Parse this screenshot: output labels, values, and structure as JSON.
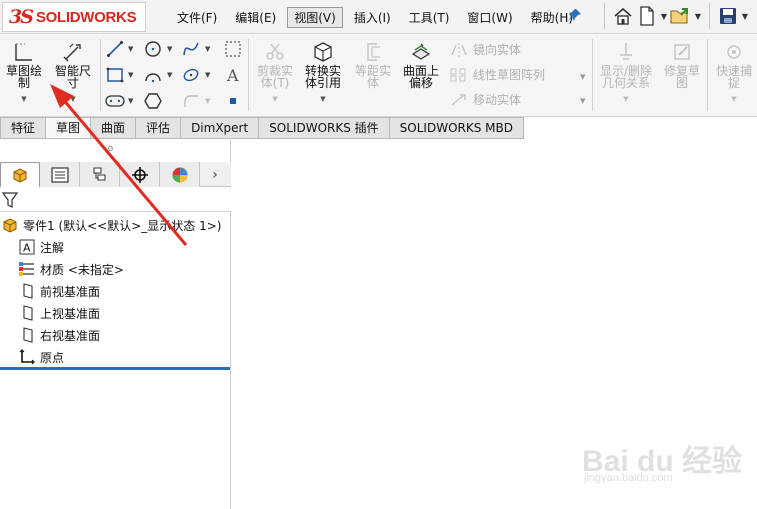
{
  "app": {
    "logo_prefix": "3S",
    "logo_text": "SOLIDWORKS"
  },
  "menu": [
    {
      "label": "文件(F)"
    },
    {
      "label": "编辑(E)"
    },
    {
      "label": "视图(V)"
    },
    {
      "label": "插入(I)"
    },
    {
      "label": "工具(T)"
    },
    {
      "label": "窗口(W)"
    },
    {
      "label": "帮助(H)"
    }
  ],
  "quickbar_icons": [
    "home-icon",
    "new-document-icon",
    "open-folder-icon",
    "save-icon"
  ],
  "ribbon": {
    "sketch": {
      "line1": "草图绘",
      "line2": "制"
    },
    "smart_dimension": {
      "line1": "智能尺",
      "line2": "寸"
    },
    "trim": {
      "line1": "剪裁实",
      "line2": "体(T)"
    },
    "convert": {
      "line1": "转换实",
      "line2": "体引用"
    },
    "offset": {
      "line1": "等距实",
      "line2": "体"
    },
    "surface_offset": {
      "line1": "曲面上",
      "line2": "偏移"
    },
    "mirror": "镜向实体",
    "linear_pattern": "线性草图阵列",
    "move": "移动实体",
    "show_relations": {
      "line1": "显示/删除",
      "line2": "几何关系"
    },
    "repair": {
      "line1": "修复草",
      "line2": "图"
    },
    "quick_snap": {
      "line1": "快速捕",
      "line2": "捉"
    }
  },
  "tabs": [
    {
      "label": "特征",
      "active": false
    },
    {
      "label": "草图",
      "active": true
    },
    {
      "label": "曲面",
      "active": false
    },
    {
      "label": "评估",
      "active": false
    },
    {
      "label": "DimXpert",
      "active": false
    },
    {
      "label": "SOLIDWORKS 插件",
      "active": false
    },
    {
      "label": "SOLIDWORKS MBD",
      "active": false
    }
  ],
  "panel_tabs": [
    "feature-manager-icon",
    "property-manager-icon",
    "configuration-manager-icon",
    "dimxpert-manager-icon",
    "display-manager-icon"
  ],
  "tree": {
    "root": "零件1 (默认<<默认>_显示状态 1>)",
    "items": [
      {
        "label": "注解",
        "icon": "annotation-icon"
      },
      {
        "label": "材质 <未指定>",
        "icon": "material-icon"
      },
      {
        "label": "前视基准面",
        "icon": "plane-icon"
      },
      {
        "label": "上视基准面",
        "icon": "plane-icon"
      },
      {
        "label": "右视基准面",
        "icon": "plane-icon"
      },
      {
        "label": "原点",
        "icon": "origin-icon"
      }
    ]
  },
  "watermark": {
    "text": "Bai du 经验",
    "sub": "jingyan.baidu.com"
  },
  "colors": {
    "accent_red": "#d9261c",
    "selection_blue": "#2a6fb8",
    "annotation_red": "#e02b20"
  }
}
